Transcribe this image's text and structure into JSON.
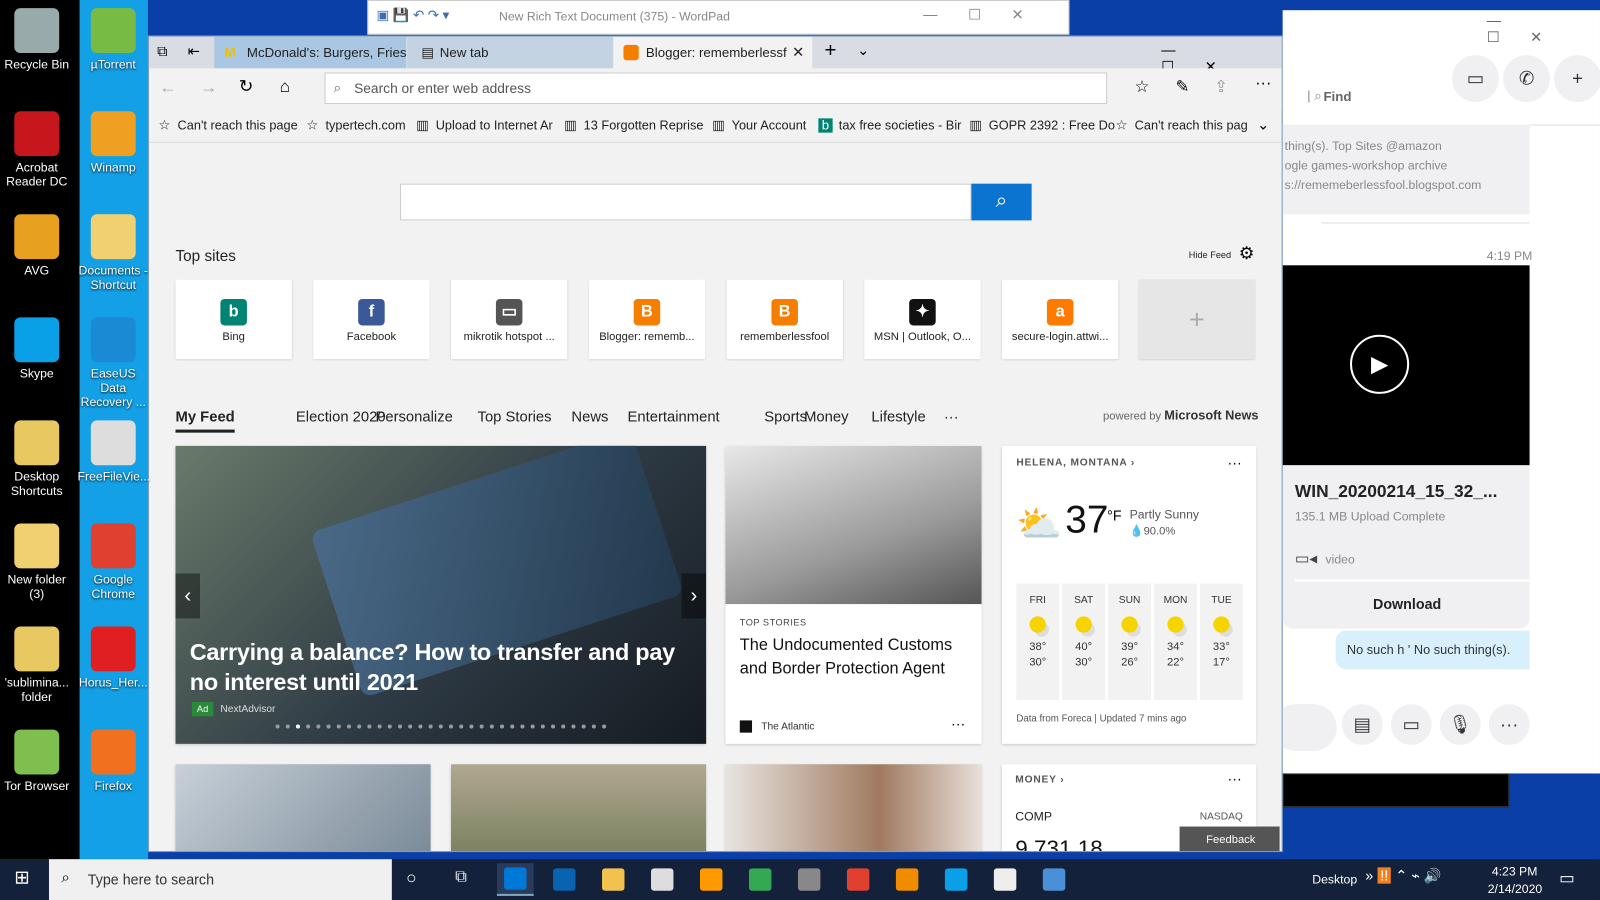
{
  "desktop": {
    "col1": [
      {
        "label": "Recycle Bin",
        "color": "#9aa"
      },
      {
        "label": "Acrobat Reader DC",
        "color": "#c8161d"
      },
      {
        "label": "AVG",
        "color": "#e8a020"
      },
      {
        "label": "Skype",
        "color": "#0aa0e8"
      },
      {
        "label": "Desktop Shortcuts",
        "color": "#e8c860"
      },
      {
        "label": "New folder (3)",
        "color": "#f0d070"
      },
      {
        "label": "'sublimina... folder",
        "color": "#e8c860"
      },
      {
        "label": "Tor Browser",
        "color": "#7fbf4f"
      }
    ],
    "col2": [
      {
        "label": "µTorrent",
        "color": "#77bb44"
      },
      {
        "label": "Winamp",
        "color": "#f0a020"
      },
      {
        "label": "Documents - Shortcut",
        "color": "#f0d070"
      },
      {
        "label": "EaseUS Data Recovery ...",
        "color": "#1a8ad4"
      },
      {
        "label": "FreeFileVie...",
        "color": "#ddd"
      },
      {
        "label": "Google Chrome",
        "color": "#e04030"
      },
      {
        "label": "Horus_Her...",
        "color": "#e02020"
      },
      {
        "label": "Firefox",
        "color": "#f07020"
      }
    ]
  },
  "wordpad": {
    "title": "New Rich Text Document (375) - WordPad"
  },
  "browser": {
    "tabs": [
      {
        "label": "McDonald's: Burgers, Fries &",
        "icon": "mcdonalds-icon"
      },
      {
        "label": "New tab",
        "icon": "newtab-icon"
      },
      {
        "label": "Blogger: rememberlessf",
        "icon": "blogger-icon",
        "active": true
      }
    ],
    "address_placeholder": "Search or enter web address",
    "favorites": [
      {
        "label": "Can't reach this page",
        "icon": "star-icon"
      },
      {
        "label": "typertech.com",
        "icon": "star-icon"
      },
      {
        "label": "Upload to Internet Ar",
        "icon": "archive-icon"
      },
      {
        "label": "13 Forgotten Reprise",
        "icon": "archive-icon"
      },
      {
        "label": "Your Account",
        "icon": "archive-icon"
      },
      {
        "label": "tax free societies - Bir",
        "icon": "bing-icon"
      },
      {
        "label": "GOPR 2392 : Free Do",
        "icon": "archive-icon"
      },
      {
        "label": "Can't reach this pag",
        "icon": "star-icon"
      }
    ],
    "top_sites_label": "Top sites",
    "hide_feed": "Hide Feed",
    "top_sites": [
      {
        "label": "Bing",
        "glyph": "b",
        "color": "#008373"
      },
      {
        "label": "Facebook",
        "glyph": "f",
        "color": "#3b5998"
      },
      {
        "label": "mikrotik hotspot ...",
        "glyph": "▭",
        "color": "#555"
      },
      {
        "label": "Blogger: rememb...",
        "glyph": "B",
        "color": "#f57d00"
      },
      {
        "label": "rememberlessfool",
        "glyph": "B",
        "color": "#f57d00"
      },
      {
        "label": "MSN | Outlook, O...",
        "glyph": "✦",
        "color": "#111"
      },
      {
        "label": "secure-login.attwi...",
        "glyph": "a",
        "color": "#ff7a00"
      }
    ],
    "add_site": "+",
    "feed_tabs": [
      "My Feed",
      "Election 2020",
      "Personalize",
      "Top Stories",
      "News",
      "Entertainment",
      "Sports",
      "Money",
      "Lifestyle",
      "···"
    ],
    "powered_by": "powered by",
    "powered_brand": "Microsoft News",
    "hero": {
      "title": "Carrying a balance? How to transfer and pay no interest until 2021",
      "ad": "Ad",
      "source": "NextAdvisor"
    },
    "story": {
      "category": "TOP STORIES",
      "title": "The Undocumented Customs and Border Protection Agent",
      "source": "The Atlantic"
    },
    "weather": {
      "location": "HELENA, MONTANA",
      "temp": "37",
      "unit": "°F",
      "condition": "Partly Sunny",
      "precip": "90.0%",
      "days": [
        {
          "d": "FRI",
          "hi": "38°",
          "lo": "30°"
        },
        {
          "d": "SAT",
          "hi": "40°",
          "lo": "30°"
        },
        {
          "d": "SUN",
          "hi": "39°",
          "lo": "26°"
        },
        {
          "d": "MON",
          "hi": "34°",
          "lo": "22°"
        },
        {
          "d": "TUE",
          "hi": "33°",
          "lo": "17°"
        }
      ],
      "footer": "Data from Foreca | Updated 7 mins ago"
    },
    "money": {
      "label": "MONEY",
      "symbol": "COMP",
      "exchange": "NASDAQ",
      "value": "9,731.18"
    },
    "feedback": "Feedback"
  },
  "skype": {
    "find": "Find",
    "msg_lines": [
      "thing(s).  Top Sites     @amazon",
      "ogle games-workshop archive",
      "s://rememeberlessfool.blogspot.com"
    ],
    "time": "4:19 PM",
    "file_name": "WIN_20200214_15_32_...",
    "file_status": "135.1 MB Upload Complete",
    "file_type": "video",
    "download": "Download",
    "bubble": "No such h ' No such thing(s)."
  },
  "taskbar": {
    "search_placeholder": "Type here to search",
    "desktop": "Desktop",
    "time": "4:23 PM",
    "date": "2/14/2020",
    "apps": [
      "#0078d7",
      "#0a63b0",
      "#f2c14e",
      "#ddd",
      "#ff9900",
      "#34a853",
      "#888",
      "#e04030",
      "#f08c00",
      "#0aa0e8",
      "#eee",
      "#4a90d9"
    ]
  }
}
